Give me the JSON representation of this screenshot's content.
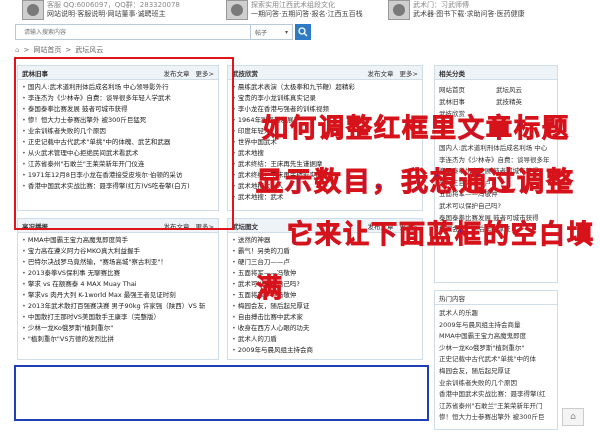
{
  "top": {
    "items": [
      {
        "line1": "客服 QQ:6006097，QQ群：283320078",
        "line2": "网站说明·客服说明·网站董事·诚聘班主"
      },
      {
        "line1": "探索实用江西武术组段文化",
        "line2": "一期问答·五期问答·报名·江西五百栈"
      },
      {
        "line1": "武术门：习武师傅",
        "line2": "武术器·图书下载·求助问答·医药健康"
      }
    ]
  },
  "search": {
    "placeholder": "请输入搜索内容",
    "select_value": "帖子",
    "button_icon": "search-icon"
  },
  "breadcrumb": {
    "home": "网站首页",
    "sep": ">",
    "current": "武坛风云"
  },
  "panel_wulin": {
    "title": "武林旧事",
    "post": "发布文章",
    "more": "更多>",
    "items": [
      "国内人:武术道利刑体后成名利场 中心领导影外行",
      "李连杰为《少林寺》自费：谈导很多年轻人学武术",
      "泰国泰拳比赛发展 鼓者可城市获得",
      "惨！恒大力士参赛出擎外 被300斤巨猛死",
      "业余训练者失败的几个原因",
      "正史记载中古代武术\"单挑\"中的体魄、武艺和武器",
      "从火武术管理中心拒绝民间武术看武术",
      "江苏省泰州\"石敢兰\"王莱荣新年开门仪连",
      "1971年12月8日李小龙在香港接受皮埃尔·伯顿的采访",
      "香港中国武术实战比赛：聂李得擎(红方)VS吃卷擎(白方)"
    ]
  },
  "panel_wuji": {
    "title": "武技欣赏",
    "post": "发布文章",
    "more": "更多>",
    "items": [
      "晨练武术表演（太极拳和九节鞭）超精彩",
      "宝贵的李小龙训练真实记录",
      "李小龙在香港与强者的训练视频",
      "1964年跆拳道发展了",
      "印度年轻人",
      "世界中国武术",
      "武术地搜",
      "武术终结：王床再先生谨据摩",
      "武术终结：王床再生精彩实战",
      "武术地搜大人人",
      "武术地搜：武术"
    ]
  },
  "panel_related": {
    "title": "相关分类",
    "links": [
      "网站首页",
      "武坛风云",
      "武林旧事",
      "武技精英",
      "武技欣赏",
      ""
    ],
    "items": [
      "国内人:武术道利刑体后成名利场 中心",
      "李连杰为《少林寺》自费：谈导很多年",
      "泰国泰拳比赛发展 鼓者可城市获得",
      "硬门三台刀——卢",
      "五面将军——冯敬仲",
      "武术可以保护自己吗?",
      "泰国泰拳比赛发展 鼓者可城市获得",
      "梅园会友，随后起兄厚证"
    ]
  },
  "panel_gaokuang": {
    "title": "高况播报",
    "post": "发布文章",
    "more": "更多>",
    "items": [
      "MMA中国霸王宝力高魔鬼即度简手",
      "宝力高在遵义阿力谷MKO真大利益握手",
      "巴特尔决战罗马竟然输，\"赛场高城\"察古利亚\"！",
      "2013泰拳VS保利事 无聊赛比赛",
      "擎求 vs 在额赛泰 4 MAX Muay Thai",
      "擎求vs 肉丹大列 K-1world Max 最强王者见证时刻",
      "2013年武术散打百强赛决赛 男子90kg 许家强（陕西）VS 斩",
      "中国散打王那时VS美国散手王康李（完整版）",
      "少林一龙Ko俄罗斯\"植刺重尔\"",
      "\"植刺重尔\"VS方德的发烈比拼"
    ]
  },
  "panel_wuzheng": {
    "title": "武坛图文",
    "post": "发布文章",
    "more": "更多>",
    "items": [
      "送然的神器",
      "霸气！另类的刀盾",
      "硬门三台刀——卢",
      "五面将军——冯敬仲",
      "武术可以保护自己吗?",
      "五面将军——冯敬仲",
      "梅园会友，随后起兄厚证",
      "自由搏击比赛中武术家",
      "收身在西方人心眼的功夫",
      "武术人的刀盾",
      "2009年与晨风组主持会商"
    ]
  },
  "panel_hot": {
    "title": "热门内容",
    "items": [
      "武术人的乐趣",
      "2009年与晨风组主持会商量",
      "MMA中国霸王宝力高魔鬼即度",
      "少林一龙Ko俄罗斯\"植刺重尔\"",
      "正史记载中古代武术\"单挑\"中的体",
      "梅园会友，随后起兄厚证",
      "业余训练者失败的几个原因",
      "香港中国武术实战比赛：聂李得擎(红",
      "江苏省泰州\"石敢兰\"王莱荣新年开门",
      "惨！恒大力士参赛出擎外 被300斤巨"
    ]
  },
  "annotation": {
    "line1": "如何调整红框里文章标题",
    "line2": "显示数目，我想通过调整",
    "line3": "它来让下面蓝框的空白填",
    "line4": "满"
  },
  "scroll_top_icon": "arrow-up-icon"
}
